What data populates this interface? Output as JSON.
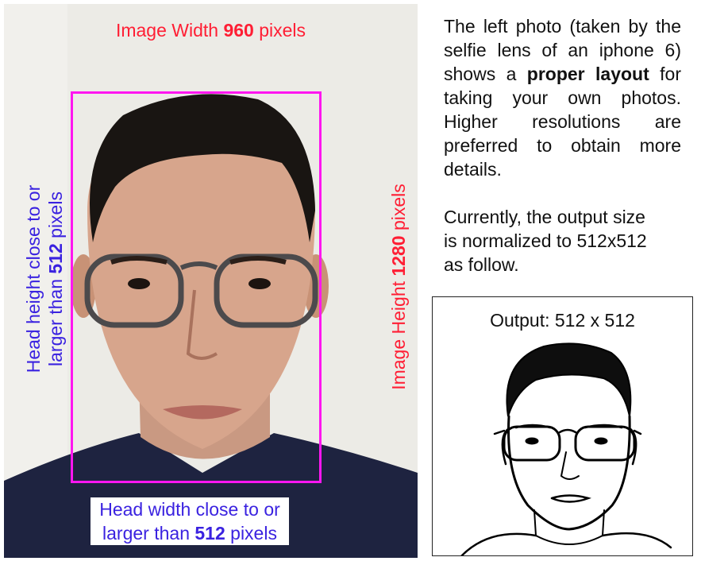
{
  "photo": {
    "image_width_prefix": "Image Width ",
    "image_width_value": "960",
    "image_width_suffix": " pixels",
    "image_height_prefix": "Image Height ",
    "image_height_value": "1280",
    "image_height_suffix": " pixels",
    "head_height_line1": "Head height close to or",
    "head_height_line2_prefix": "larger than ",
    "head_height_value": "512",
    "head_height_suffix": " pixels",
    "head_width_line1": "Head width close to or",
    "head_width_line2_prefix": "larger than ",
    "head_width_value": "512",
    "head_width_suffix": " pixels"
  },
  "description": {
    "p1_a": "The left photo (taken by the selfie lens of an iphone 6) shows a ",
    "p1_bold": "proper layout",
    "p1_b": " for taking your own photos. Higher resolutions are preferred to obtain more details.",
    "p2_line1": "Currently, the output size",
    "p2_line2": "is normalized to 512x512",
    "p2_line3": "as follow."
  },
  "output": {
    "title": "Output: 512 x 512"
  },
  "colors": {
    "red_label": "#ff1e34",
    "blue_label": "#3a22e0",
    "head_box": "#ff16f0"
  }
}
